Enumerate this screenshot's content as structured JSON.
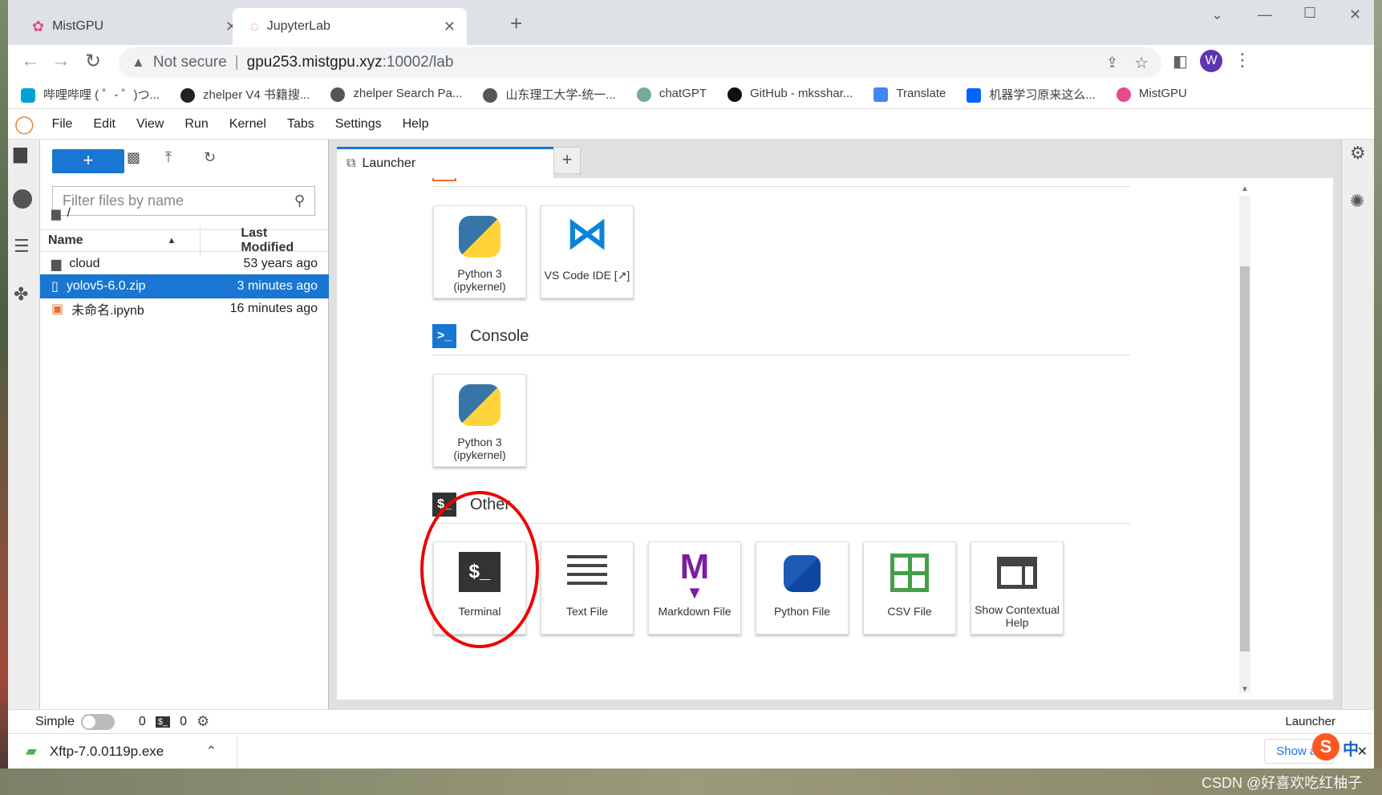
{
  "browser": {
    "tabs": [
      {
        "title": "MistGPU",
        "active": false
      },
      {
        "title": "JupyterLab",
        "active": true
      }
    ],
    "new_tab": "+",
    "close": "✕",
    "address": {
      "security": "Not secure",
      "host": "gpu253.mistgpu.xyz",
      "path": ":10002/lab"
    },
    "profile_initial": "W",
    "bookmarks": [
      {
        "label": "哔哩哔哩 ( ゜- ゜)つ...",
        "color": "#00a1d6"
      },
      {
        "label": "zhelper V4 书籍搜...",
        "color": "#222"
      },
      {
        "label": "zhelper Search Pa...",
        "color": "#555"
      },
      {
        "label": "山东理工大学-统一...",
        "color": "#555"
      },
      {
        "label": "chatGPT",
        "color": "#74aa9c"
      },
      {
        "label": "GitHub - mksshar...",
        "color": "#111"
      },
      {
        "label": "Translate",
        "color": "#4285f4"
      },
      {
        "label": "机器学习原来这么...",
        "color": "#0066ff"
      },
      {
        "label": "MistGPU",
        "color": "#e64a8b"
      }
    ]
  },
  "menu": [
    "File",
    "Edit",
    "View",
    "Run",
    "Kernel",
    "Tabs",
    "Settings",
    "Help"
  ],
  "filebrowser": {
    "new_label": "+",
    "filter_placeholder": "Filter files by name",
    "path": "/",
    "col_name": "Name",
    "col_modified": "Last Modified",
    "files": [
      {
        "name": "cloud",
        "modified": "53 years ago",
        "kind": "folder",
        "selected": false
      },
      {
        "name": "yolov5-6.0.zip",
        "modified": "3 minutes ago",
        "kind": "file",
        "selected": true
      },
      {
        "name": "未命名.ipynb",
        "modified": "16 minutes ago",
        "kind": "notebook",
        "selected": false
      }
    ]
  },
  "launcher": {
    "tab_title": "Launcher",
    "tab_plus": "+",
    "notebook_cards": [
      {
        "label": "Python 3 (ipykernel)"
      },
      {
        "label": "VS Code IDE [↗]"
      }
    ],
    "console_title": "Console",
    "console_cards": [
      {
        "label": "Python 3 (ipykernel)"
      }
    ],
    "other_title": "Other",
    "other_cards": [
      {
        "label": "Terminal"
      },
      {
        "label": "Text File"
      },
      {
        "label": "Markdown File"
      },
      {
        "label": "Python File"
      },
      {
        "label": "CSV File"
      },
      {
        "label": "Show Contextual Help"
      }
    ]
  },
  "status": {
    "mode": "Simple",
    "kernels": "0",
    "terminals": "0",
    "right_label": "Launcher"
  },
  "download": {
    "filename": "Xftp-7.0.0119p.exe",
    "show_all": "Show all"
  },
  "watermark": "CSDN @好喜欢吃红柚子",
  "ime": "中"
}
